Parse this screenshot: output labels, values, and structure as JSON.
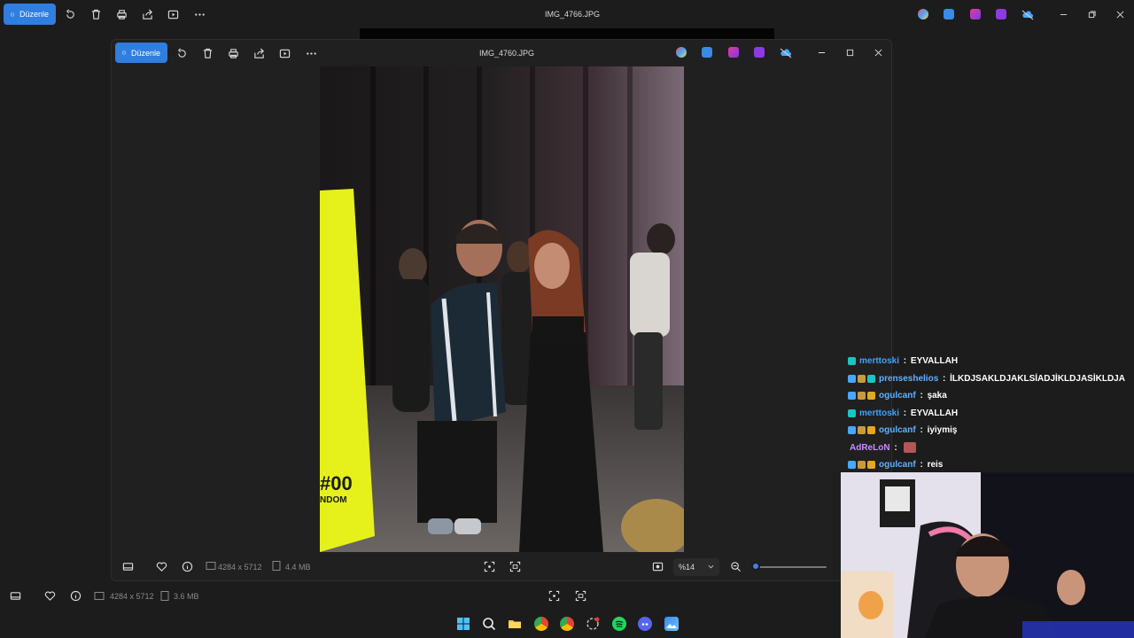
{
  "outer_window": {
    "edit_label": "Düzenle",
    "title": "IMG_4766.JPG",
    "dimensions": "4284 x 5712",
    "file_size": "3.6 MB"
  },
  "inner_window": {
    "edit_label": "Düzenle",
    "title": "IMG_4760.JPG",
    "dimensions": "4284 x 5712",
    "file_size": "4.4 MB",
    "zoom_value": "%14"
  },
  "photo": {
    "banner_text_line1": "#00",
    "banner_text_line2": "NDOM"
  },
  "chat": [
    {
      "user": "merttoski",
      "user_color": "#3ea3ff",
      "badges": [
        "#19c6c1"
      ],
      "message": "EYVALLAH",
      "emote": false
    },
    {
      "user": "prenseshelios",
      "user_color": "#5fb1ff",
      "badges": [
        "#4aa7ff",
        "#c99a3d",
        "#19c6c1"
      ],
      "message": "İLKDJSAKLDJAKLSİADJİKLDJASİKLDJA",
      "emote": false
    },
    {
      "user": "ogulcanf",
      "user_color": "#5fb1ff",
      "badges": [
        "#4aa7ff",
        "#c99a3d",
        "#e3a91e"
      ],
      "message": "şaka",
      "emote": false
    },
    {
      "user": "merttoski",
      "user_color": "#3ea3ff",
      "badges": [
        "#19c6c1"
      ],
      "message": "EYVALLAH",
      "emote": false
    },
    {
      "user": "ogulcanf",
      "user_color": "#5fb1ff",
      "badges": [
        "#4aa7ff",
        "#c99a3d",
        "#e3a91e"
      ],
      "message": "iyiymiş",
      "emote": false
    },
    {
      "user": "AdReLoN",
      "user_color": "#c98bff",
      "badges": [],
      "message": "",
      "emote": true
    },
    {
      "user": "ogulcanf",
      "user_color": "#5fb1ff",
      "badges": [
        "#4aa7ff",
        "#c99a3d",
        "#e3a91e"
      ],
      "message": "reis",
      "emote": false
    }
  ],
  "colors": {
    "accent": "#2f7ee0",
    "background": "#1c1c1c",
    "window": "#202020"
  },
  "taskbar": {
    "icons": [
      "windows-start-icon",
      "search-icon",
      "file-explorer-icon",
      "chrome-icon",
      "chrome-icon",
      "recorder-icon",
      "spotify-icon",
      "discord-icon",
      "photos-icon"
    ]
  }
}
